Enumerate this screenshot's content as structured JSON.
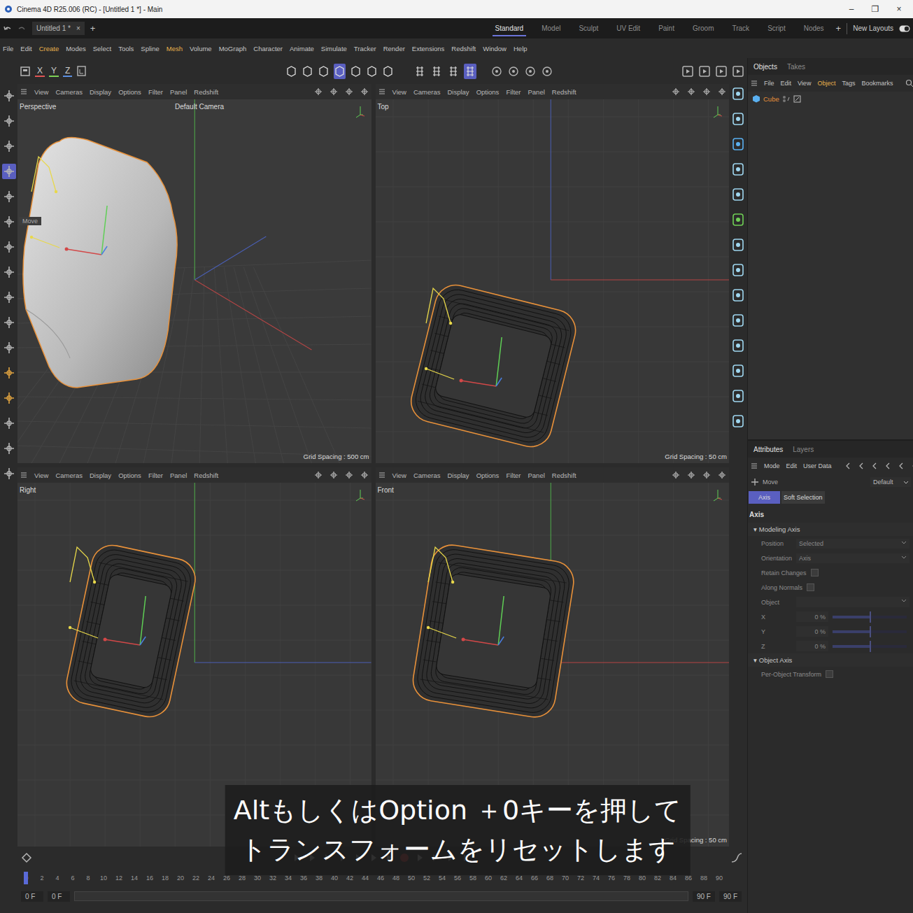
{
  "window": {
    "title": "Cinema 4D R25.006 (RC) - [Untitled 1 *] - Main",
    "controls": [
      "–",
      "❐",
      "×"
    ]
  },
  "doc_tabs": [
    {
      "label": "Untitled 1 *",
      "close": "×",
      "selected": true
    }
  ],
  "doc_tab_add": "+",
  "layouts": [
    {
      "label": "Standard",
      "selected": true
    },
    {
      "label": "Model",
      "selected": false
    },
    {
      "label": "Sculpt",
      "selected": false
    },
    {
      "label": "UV Edit",
      "selected": false
    },
    {
      "label": "Paint",
      "selected": false
    },
    {
      "label": "Groom",
      "selected": false
    },
    {
      "label": "Track",
      "selected": false
    },
    {
      "label": "Script",
      "selected": false
    },
    {
      "label": "Nodes",
      "selected": false
    }
  ],
  "layout_add": "+",
  "new_layouts": "New Layouts",
  "menu": [
    {
      "label": "File",
      "highlighted": false
    },
    {
      "label": "Edit",
      "highlighted": false
    },
    {
      "label": "Create",
      "highlighted": true
    },
    {
      "label": "Modes",
      "highlighted": false
    },
    {
      "label": "Select",
      "highlighted": false
    },
    {
      "label": "Tools",
      "highlighted": false
    },
    {
      "label": "Spline",
      "highlighted": false
    },
    {
      "label": "Mesh",
      "highlighted": true
    },
    {
      "label": "Volume",
      "highlighted": false
    },
    {
      "label": "MoGraph",
      "highlighted": false
    },
    {
      "label": "Character",
      "highlighted": false
    },
    {
      "label": "Animate",
      "highlighted": false
    },
    {
      "label": "Simulate",
      "highlighted": false
    },
    {
      "label": "Tracker",
      "highlighted": false
    },
    {
      "label": "Render",
      "highlighted": false
    },
    {
      "label": "Extensions",
      "highlighted": false
    },
    {
      "label": "Redshift",
      "highlighted": false
    },
    {
      "label": "Window",
      "highlighted": false
    },
    {
      "label": "Help",
      "highlighted": false
    }
  ],
  "axis_toggles": [
    {
      "label": "X",
      "color": "#e05555"
    },
    {
      "label": "Y",
      "color": "#7ccf55"
    },
    {
      "label": "Z",
      "color": "#5b8fe0"
    }
  ],
  "viewport_menu": [
    "View",
    "Cameras",
    "Display",
    "Options",
    "Filter",
    "Panel",
    "Redshift"
  ],
  "viewports": [
    {
      "name": "Perspective",
      "camera": "Default Camera",
      "grid": "Grid Spacing : 500 cm",
      "kind": "perspective"
    },
    {
      "name": "Top",
      "grid": "Grid Spacing : 50 cm",
      "kind": "top"
    },
    {
      "name": "Right",
      "kind": "right"
    },
    {
      "name": "Front",
      "grid": "Grid Spacing : 50 cm",
      "kind": "front"
    }
  ],
  "tooltip": "Move",
  "objects_panel": {
    "tabs": [
      {
        "label": "Objects",
        "selected": true
      },
      {
        "label": "Takes",
        "selected": false
      }
    ],
    "menu": [
      {
        "label": "File",
        "highlighted": false
      },
      {
        "label": "Edit",
        "highlighted": false
      },
      {
        "label": "View",
        "highlighted": false
      },
      {
        "label": "Object",
        "highlighted": true
      },
      {
        "label": "Tags",
        "highlighted": false
      },
      {
        "label": "Bookmarks",
        "highlighted": false
      }
    ],
    "items": [
      {
        "name": "Cube",
        "selected": true
      }
    ]
  },
  "attributes_panel": {
    "tabs": [
      {
        "label": "Attributes",
        "selected": true
      },
      {
        "label": "Layers",
        "selected": false
      }
    ],
    "menu": [
      "Mode",
      "Edit",
      "User Data"
    ],
    "tool": "Move",
    "preset": "Default",
    "subtabs": [
      {
        "label": "Axis",
        "selected": true
      },
      {
        "label": "Soft Selection",
        "selected": false
      }
    ],
    "heading": "Axis",
    "sections": [
      {
        "title": "Modeling Axis",
        "toggle": "▾",
        "expanded": true,
        "fields": [
          {
            "kind": "dropdown",
            "label": "Position",
            "value": "Selected"
          },
          {
            "kind": "dropdown",
            "label": "Orientation",
            "value": "Axis"
          },
          {
            "kind": "checkbox",
            "label": "Retain Changes",
            "checked": false
          },
          {
            "kind": "checkbox",
            "label": "Along Normals",
            "checked": false
          },
          {
            "kind": "link",
            "label": "Object"
          },
          {
            "kind": "slider",
            "label": "X",
            "value": "0 %",
            "level": 0.5
          },
          {
            "kind": "slider",
            "label": "Y",
            "value": "0 %",
            "level": 0.5
          },
          {
            "kind": "slider",
            "label": "Z",
            "value": "0 %",
            "level": 0.5
          }
        ]
      },
      {
        "title": "Object Axis",
        "toggle": "▾",
        "expanded": true,
        "fields": [
          {
            "kind": "checkbox",
            "label": "Per-Object Transform",
            "checked": false
          }
        ]
      }
    ]
  },
  "timeline": {
    "ticks": [
      "0",
      "2",
      "4",
      "6",
      "8",
      "10",
      "12",
      "14",
      "16",
      "18",
      "20",
      "22",
      "24",
      "26",
      "28",
      "30",
      "32",
      "34",
      "36",
      "38",
      "40",
      "42",
      "44",
      "46",
      "48",
      "50",
      "52",
      "54",
      "56",
      "58",
      "60",
      "62",
      "64",
      "66",
      "68",
      "70",
      "72",
      "74",
      "76",
      "78",
      "80",
      "82",
      "84",
      "86",
      "88",
      "90"
    ],
    "start": "0 F",
    "current": "0 F",
    "end": "90 F",
    "preview_end": "90 F",
    "playhead": {
      "level": 0
    }
  },
  "subtitle": {
    "lines": [
      "AltもしくはOption ＋0キーを押して",
      "トランスフォームをリセットします"
    ]
  }
}
